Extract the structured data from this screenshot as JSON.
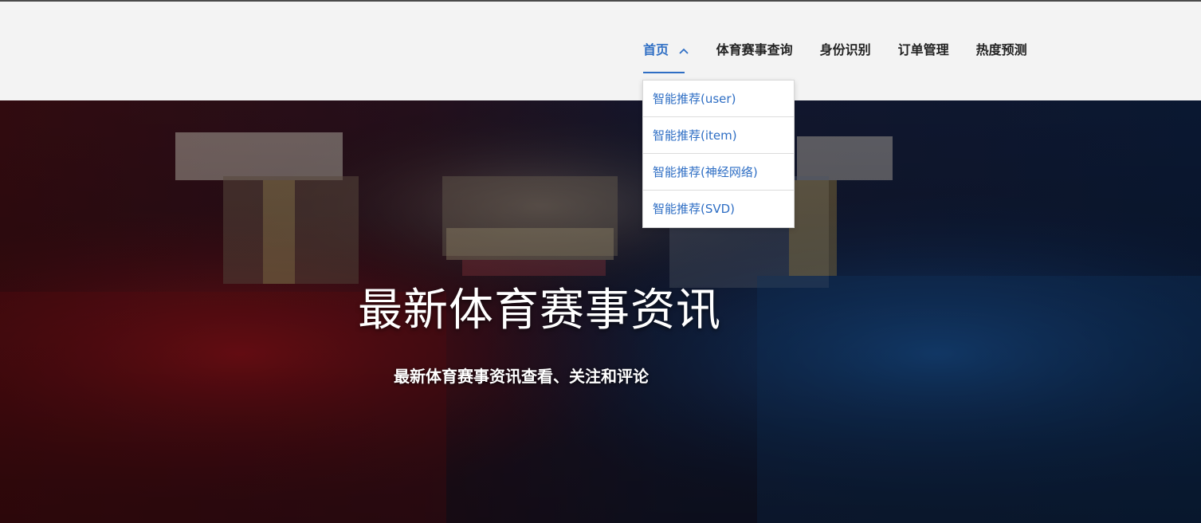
{
  "nav": {
    "items": [
      {
        "label": "首页",
        "active": true
      },
      {
        "label": "体育赛事查询",
        "active": false
      },
      {
        "label": "身份识别",
        "active": false
      },
      {
        "label": "订单管理",
        "active": false
      },
      {
        "label": "热度预测",
        "active": false
      }
    ],
    "active_color": "#2e6ec4"
  },
  "dropdown": {
    "items": [
      {
        "label": "智能推荐(user)"
      },
      {
        "label": "智能推荐(item)"
      },
      {
        "label": "智能推荐(神经网络)"
      },
      {
        "label": "智能推荐(SVD)"
      }
    ]
  },
  "hero": {
    "title": "最新体育赛事资讯",
    "subtitle": "最新体育赛事资讯查看、关注和评论"
  },
  "icons": {
    "active_nav_chevron": "chevron-up-icon"
  }
}
